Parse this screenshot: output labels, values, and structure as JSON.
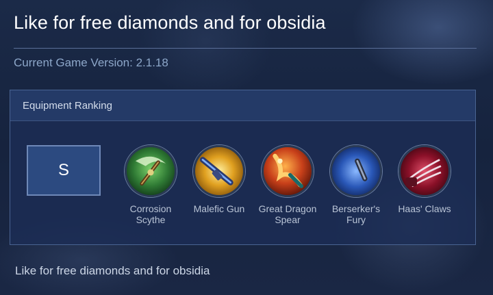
{
  "header": {
    "title": "Like for free diamonds and for obsidia",
    "version": "Current Game Version: 2.1.18"
  },
  "panel": {
    "title": "Equipment Ranking",
    "tier": "S",
    "items": [
      {
        "label": "Corrosion Scythe",
        "icon": "corrosion-scythe-icon",
        "color": "#3c8a3a"
      },
      {
        "label": "Malefic Gun",
        "icon": "malefic-gun-icon",
        "color": "#d8a020"
      },
      {
        "label": "Great Dragon Spear",
        "icon": "great-dragon-spear-icon",
        "color": "#d8581c"
      },
      {
        "label": "Berserker's Fury",
        "icon": "berserkers-fury-icon",
        "color": "#2a5ab8"
      },
      {
        "label": "Haas' Claws",
        "icon": "haas-claws-icon",
        "color": "#b02038"
      }
    ]
  },
  "footer": {
    "text": "Like for free diamonds and for obsidia"
  }
}
